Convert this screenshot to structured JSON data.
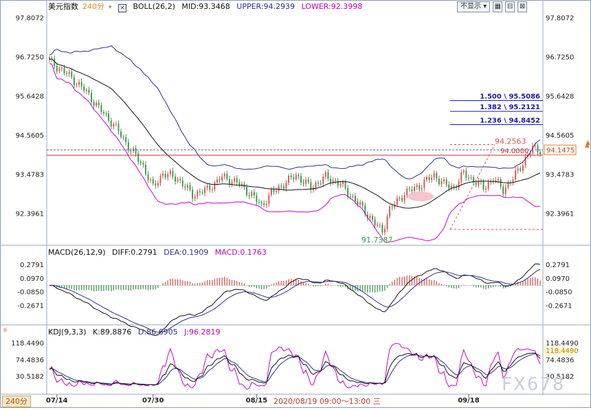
{
  "header": {
    "instrument": "美元指数",
    "period": "240分",
    "boll": {
      "label": "BOLL(26,2)",
      "mid": "MID:93.3468",
      "upper": "UPPER:94.2939",
      "lower": "LOWER:92.3998"
    },
    "macd": {
      "label": "MACD(26,12,9)",
      "diff": "DIFF:0.2791",
      "dea": "DEA:0.1909",
      "macd": "MACD:0.1763"
    },
    "kdj": {
      "label": "KDJ(9,3,3)",
      "k": "K:89.8876",
      "d": "D:86.6905",
      "j": "J:96.2819"
    }
  },
  "toolbar": {
    "hide_label": "不显示",
    "period_tab": "240分"
  },
  "period_info": "2020/08/19 09:00～13:00 三",
  "watermark": "FX678",
  "colors": {
    "background": "#ffffff",
    "price_up": "#e0554f",
    "price_down": "#3c9a4a",
    "upper_band": "#2d2f8c",
    "mid_band": "#111111",
    "lower_band": "#d000d0",
    "diff_line": "#111111",
    "dea_line": "#2d2f8c",
    "k_line": "#111111",
    "d_line": "#2d2f8c",
    "j_line": "#d000d0",
    "fib_line": "#1a1ab0",
    "hline": "#d32f2f"
  },
  "chart_data": [
    {
      "type": "candlestick",
      "title": "美元指数 240分",
      "overlays": [
        "UPPER",
        "MID",
        "LOWER"
      ],
      "x_labels": [
        "07/14",
        "07/30",
        "08/15",
        "09/18"
      ],
      "x_label_bar_index": [
        3,
        42,
        84,
        170
      ],
      "y_ticks": [
        97.8072,
        96.725,
        95.6428,
        94.5605,
        93.4783,
        92.3961
      ],
      "ylim": [
        91.55,
        97.95
      ],
      "annotations": {
        "high_label": "94.2563",
        "high_value": 94.2563,
        "low_label": "91.7387",
        "low_value": 91.7387,
        "hline_value": 94.0,
        "hline_label": "94.0000",
        "current_price_label": "94.1475",
        "current_price": 94.1475,
        "fib_levels": [
          {
            "label": "1.500 \\ 95.5086",
            "value": 95.5086
          },
          {
            "label": "1.382 \\ 95.2121",
            "value": 95.2121
          },
          {
            "label": "1.236 \\ 94.8452",
            "value": 94.8452
          }
        ]
      },
      "series_close_keypoints": [
        [
          0,
          96.6
        ],
        [
          8,
          96.2
        ],
        [
          15,
          95.75
        ],
        [
          20,
          95.3
        ],
        [
          26,
          94.85
        ],
        [
          32,
          94.25
        ],
        [
          38,
          93.7
        ],
        [
          42,
          93.1
        ],
        [
          46,
          93.5
        ],
        [
          52,
          93.35
        ],
        [
          58,
          92.9
        ],
        [
          64,
          93.05
        ],
        [
          70,
          93.4
        ],
        [
          76,
          93.25
        ],
        [
          82,
          92.9
        ],
        [
          86,
          92.6
        ],
        [
          90,
          92.95
        ],
        [
          95,
          93.2
        ],
        [
          100,
          93.45
        ],
        [
          106,
          93.1
        ],
        [
          112,
          93.4
        ],
        [
          118,
          93.2
        ],
        [
          124,
          92.75
        ],
        [
          128,
          92.45
        ],
        [
          132,
          92.1
        ],
        [
          135,
          91.9
        ],
        [
          138,
          92.5
        ],
        [
          144,
          92.95
        ],
        [
          150,
          93.15
        ],
        [
          156,
          93.45
        ],
        [
          160,
          93.2
        ],
        [
          164,
          93.1
        ],
        [
          168,
          93.5
        ],
        [
          172,
          93.3
        ],
        [
          176,
          93.1
        ],
        [
          180,
          93.35
        ],
        [
          184,
          93.05
        ],
        [
          188,
          93.35
        ],
        [
          192,
          93.8
        ],
        [
          196,
          94.2
        ],
        [
          198,
          94.15
        ]
      ]
    },
    {
      "type": "bar+line",
      "title": "MACD(26,12,9)",
      "y_ticks": [
        0.2791,
        0.097,
        -0.085,
        -0.2671
      ],
      "ylim": [
        -0.5,
        0.38
      ],
      "series": [
        {
          "name": "DIFF",
          "value": 0.2791
        },
        {
          "name": "DEA",
          "value": 0.1909
        },
        {
          "name": "MACD",
          "value": 0.1763
        }
      ]
    },
    {
      "type": "line",
      "title": "KDJ(9,3,3)",
      "y_ticks": [
        118.449,
        74.4836,
        30.5182
      ],
      "ylim": [
        -10,
        135
      ],
      "current_label": "118.4490",
      "series": [
        {
          "name": "K",
          "value": 89.8876
        },
        {
          "name": "D",
          "value": 86.6905
        },
        {
          "name": "J",
          "value": 96.2819
        }
      ]
    }
  ]
}
